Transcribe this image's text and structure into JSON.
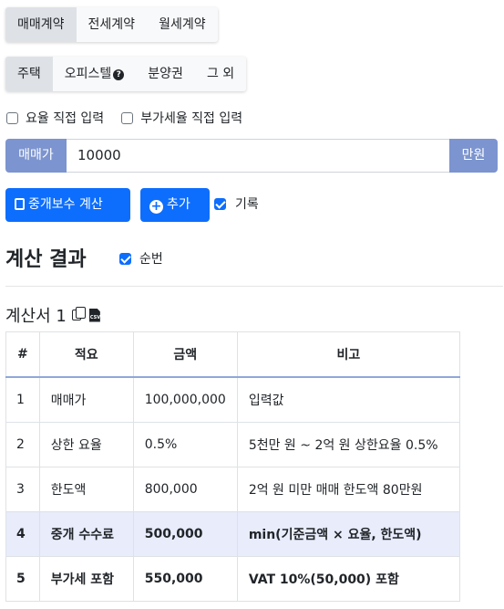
{
  "contract_tabs": [
    "매매계약",
    "전세계약",
    "월세계약"
  ],
  "property_tabs": [
    "주택",
    "오피스텔",
    "분양권",
    "그 외"
  ],
  "options": {
    "rate_direct": "요율 직접 입력",
    "vat_direct": "부가세율 직접 입력"
  },
  "price": {
    "label": "매매가",
    "value": "10000",
    "unit": "만원"
  },
  "actions": {
    "calc": "중개보수 계산",
    "add": "추가",
    "record": "기록"
  },
  "result": {
    "title": "계산 결과",
    "order": "순번"
  },
  "doc": {
    "title": "계산서 1"
  },
  "table": {
    "headers": [
      "#",
      "적요",
      "금액",
      "비고"
    ],
    "rows": [
      [
        "1",
        "매매가",
        "100,000,000",
        "입력값"
      ],
      [
        "2",
        "상한 요율",
        "0.5%",
        "5천만 원 ~ 2억 원 상한요율 0.5%"
      ],
      [
        "3",
        "한도액",
        "800,000",
        "2억 원 미만 매매 한도액 80만원"
      ],
      [
        "4",
        "중개 수수료",
        "500,000",
        "min(기준금액 × 요율, 한도액)"
      ],
      [
        "5",
        "부가세 포함",
        "550,000",
        "VAT 10%(50,000) 포함"
      ]
    ]
  },
  "colors": {
    "primary": "#0d6efd",
    "addon": "#7c94cf",
    "highlight_row": "#e8ecfb"
  },
  "icons": [
    "question-circle-icon",
    "calculator-icon",
    "plus-circle-icon",
    "copy-icon",
    "csv-file-icon"
  ]
}
